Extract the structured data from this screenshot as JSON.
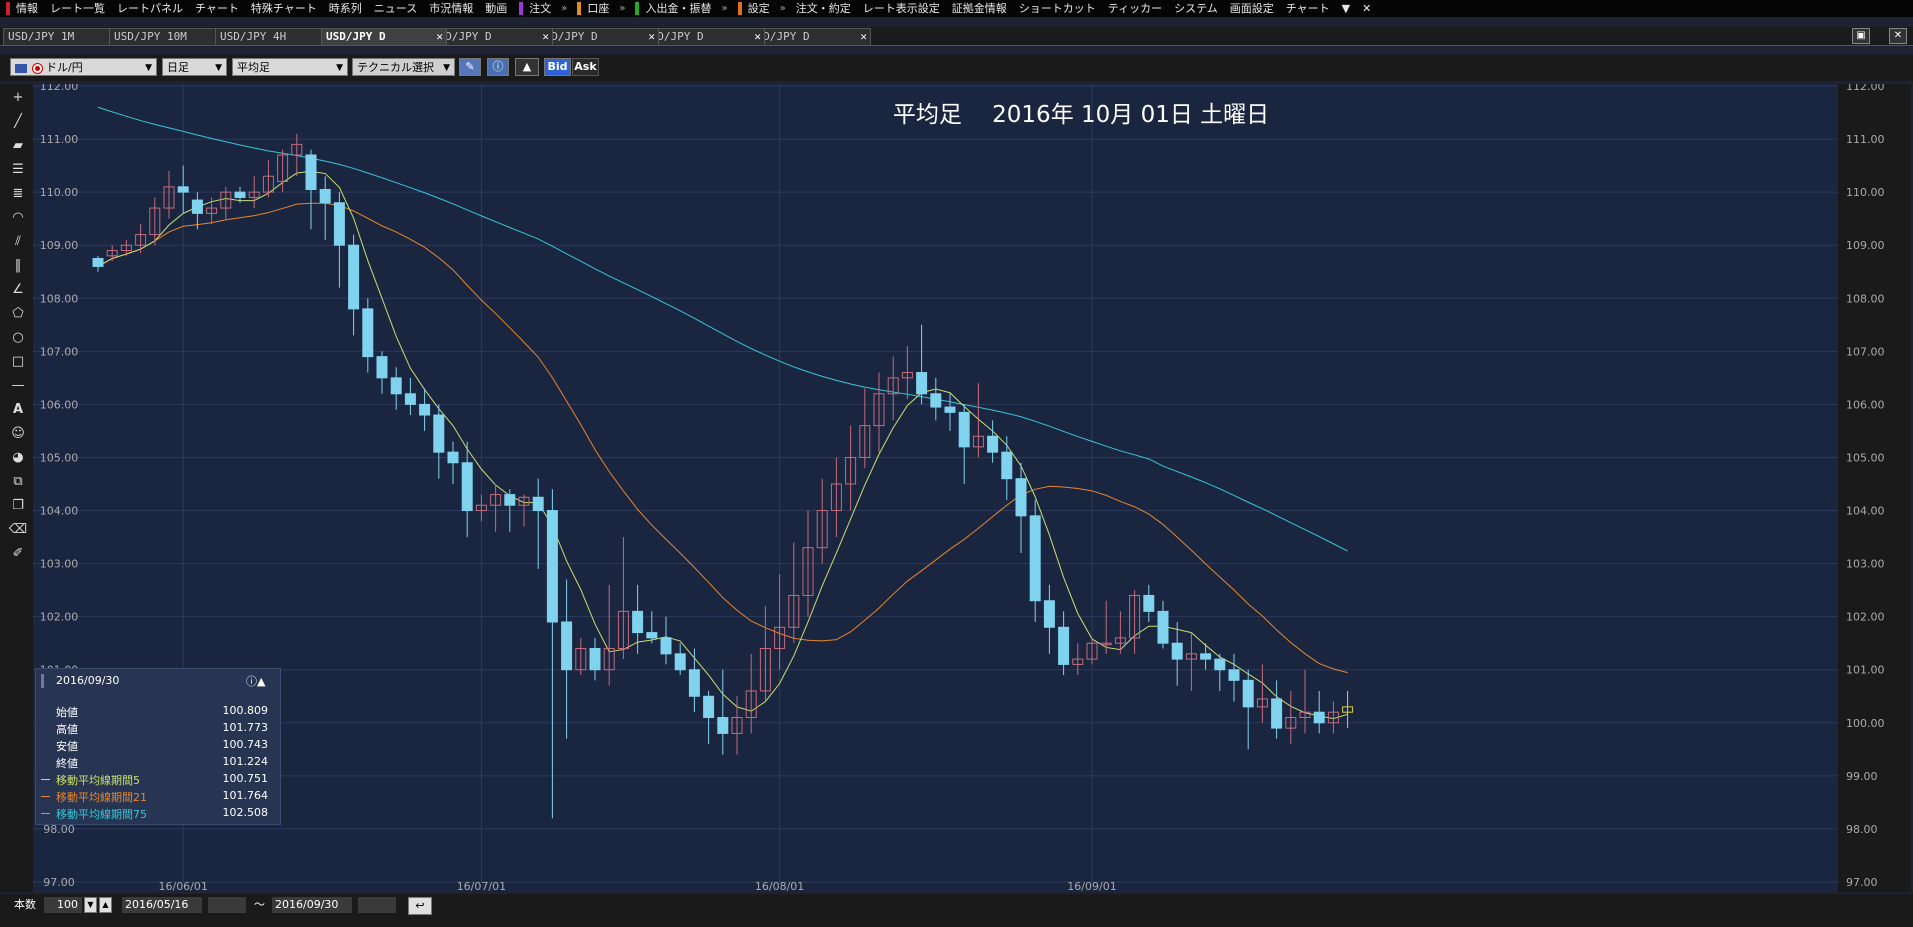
{
  "menu": {
    "items": [
      {
        "label": "情報",
        "sep": "#cc2222"
      },
      {
        "label": "レート一覧"
      },
      {
        "label": "レートパネル"
      },
      {
        "label": "チャート"
      },
      {
        "label": "特殊チャート"
      },
      {
        "label": "時系列"
      },
      {
        "label": "ニュース"
      },
      {
        "label": "市況情報"
      },
      {
        "label": "動画"
      },
      {
        "label": "注文",
        "sep": "#9a3ad0",
        "more": true
      },
      {
        "label": "口座",
        "sep": "#e09020",
        "more": true
      },
      {
        "label": "入出金・振替",
        "sep": "#22aa22",
        "more": true
      },
      {
        "label": "設定",
        "sep": "#e07020",
        "more": true
      },
      {
        "label": "注文・約定"
      },
      {
        "label": "レート表示設定"
      },
      {
        "label": "証拠金情報"
      },
      {
        "label": "ショートカット"
      },
      {
        "label": "ティッカー"
      },
      {
        "label": "システム"
      },
      {
        "label": "画面設定"
      },
      {
        "label": "チャート"
      }
    ],
    "dropdown_glyph": "▼",
    "close_glyph": "✕"
  },
  "tabs": [
    {
      "label": "USD/JPY 1M"
    },
    {
      "label": "USD/JPY 10M"
    },
    {
      "label": "USD/JPY 4H"
    },
    {
      "label": "USD/JPY D",
      "active": true
    },
    {
      "label": "USD/JPY D"
    },
    {
      "label": "USD/JPY D"
    },
    {
      "label": "USD/JPY D"
    },
    {
      "label": "USD/JPY D"
    }
  ],
  "toolbar": {
    "pair": "ドル/円",
    "period": "日足",
    "chart_type": "平均足",
    "technical": "テクニカル選択",
    "bid": "Bid",
    "ask": "Ask"
  },
  "chart_title": "平均足　 2016年 10月 01日 土曜日",
  "info": {
    "date": "2016/09/30",
    "rows": [
      {
        "label": "始値",
        "value": "100.809"
      },
      {
        "label": "高値",
        "value": "101.773"
      },
      {
        "label": "安値",
        "value": "100.743"
      },
      {
        "label": "終値",
        "value": "101.224"
      },
      {
        "label": "移動平均線期間5",
        "value": "100.751",
        "color": "#c8e070"
      },
      {
        "label": "移動平均線期間21",
        "value": "101.764",
        "color": "#e8862c"
      },
      {
        "label": "移動平均線期間75",
        "value": "102.508",
        "color": "#36c8d8"
      }
    ]
  },
  "bottom": {
    "count_label": "本数",
    "count": "100",
    "from": "2016/05/16",
    "tilde": "～",
    "to": "2016/09/30"
  },
  "colors": {
    "up": "#c46c7c",
    "down": "#7fd3ee",
    "last": "#d8d040",
    "ma5": "#c8e070",
    "ma21": "#e8862c",
    "ma75": "#36c8d8",
    "plot_bg": "#1a2540"
  },
  "chart_data": {
    "type": "candlestick",
    "y_ticks": [
      "112.00",
      "111.00",
      "110.00",
      "109.00",
      "108.00",
      "107.00",
      "106.00",
      "105.00",
      "104.00",
      "103.00",
      "102.00",
      "101.00",
      "100.00",
      "99.00",
      "98.00",
      "97.00"
    ],
    "ylim": [
      97,
      112
    ],
    "x_ticks": [
      {
        "label": "16/06/01",
        "index": 6
      },
      {
        "label": "16/07/01",
        "index": 27
      },
      {
        "label": "16/08/01",
        "index": 48
      },
      {
        "label": "16/09/01",
        "index": 70
      }
    ],
    "candles": [
      [
        108.75,
        108.8,
        108.5,
        108.6
      ],
      [
        108.8,
        109.0,
        108.7,
        108.9
      ],
      [
        108.9,
        109.1,
        108.8,
        109.0
      ],
      [
        109.0,
        109.4,
        108.85,
        109.2
      ],
      [
        109.2,
        109.9,
        109.0,
        109.7
      ],
      [
        109.7,
        110.4,
        109.5,
        110.1
      ],
      [
        110.1,
        110.5,
        109.6,
        110.0
      ],
      [
        109.85,
        110.0,
        109.3,
        109.6
      ],
      [
        109.6,
        109.9,
        109.4,
        109.7
      ],
      [
        109.7,
        110.1,
        109.5,
        110.0
      ],
      [
        110.0,
        110.1,
        109.8,
        109.9
      ],
      [
        109.9,
        110.3,
        109.7,
        110.0
      ],
      [
        110.0,
        110.6,
        109.9,
        110.3
      ],
      [
        110.2,
        110.8,
        110.0,
        110.7
      ],
      [
        110.7,
        111.1,
        110.3,
        110.9
      ],
      [
        110.7,
        110.8,
        109.3,
        110.05
      ],
      [
        110.05,
        110.3,
        109.1,
        109.8
      ],
      [
        109.8,
        110.0,
        108.2,
        109.0
      ],
      [
        109.0,
        109.2,
        107.3,
        107.8
      ],
      [
        107.8,
        108.0,
        106.6,
        106.9
      ],
      [
        106.9,
        107.0,
        106.2,
        106.5
      ],
      [
        106.5,
        106.7,
        105.9,
        106.2
      ],
      [
        106.2,
        106.5,
        105.8,
        106.0
      ],
      [
        106.0,
        106.3,
        105.5,
        105.8
      ],
      [
        105.8,
        106.0,
        104.6,
        105.1
      ],
      [
        105.1,
        105.3,
        104.5,
        104.9
      ],
      [
        104.9,
        105.3,
        103.5,
        104.0
      ],
      [
        104.0,
        104.3,
        103.8,
        104.1
      ],
      [
        104.1,
        104.5,
        103.6,
        104.3
      ],
      [
        104.3,
        104.4,
        103.6,
        104.1
      ],
      [
        104.1,
        104.3,
        103.7,
        104.25
      ],
      [
        104.25,
        104.6,
        102.9,
        104.0
      ],
      [
        104.0,
        104.4,
        98.2,
        101.9
      ],
      [
        101.9,
        102.7,
        99.7,
        101.0
      ],
      [
        101.0,
        101.6,
        100.9,
        101.4
      ],
      [
        101.4,
        101.6,
        100.8,
        101.0
      ],
      [
        101.0,
        102.6,
        100.7,
        101.4
      ],
      [
        101.4,
        103.5,
        101.2,
        102.1
      ],
      [
        102.1,
        102.6,
        101.3,
        101.7
      ],
      [
        101.7,
        102.1,
        101.5,
        101.6
      ],
      [
        101.6,
        102.0,
        101.1,
        101.3
      ],
      [
        101.3,
        101.5,
        100.9,
        101.0
      ],
      [
        101.0,
        101.4,
        100.2,
        100.5
      ],
      [
        100.5,
        100.6,
        99.6,
        100.1
      ],
      [
        100.1,
        101.0,
        99.4,
        99.8
      ],
      [
        99.8,
        100.5,
        99.4,
        100.1
      ],
      [
        100.1,
        101.3,
        99.8,
        100.6
      ],
      [
        100.6,
        102.2,
        100.4,
        101.4
      ],
      [
        101.4,
        102.8,
        101.0,
        101.8
      ],
      [
        101.8,
        103.4,
        101.5,
        102.4
      ],
      [
        102.4,
        104.0,
        102.0,
        103.3
      ],
      [
        103.3,
        104.6,
        103.0,
        104.0
      ],
      [
        104.0,
        105.0,
        103.5,
        104.5
      ],
      [
        104.5,
        105.6,
        104.0,
        105.0
      ],
      [
        105.0,
        106.3,
        104.8,
        105.6
      ],
      [
        105.6,
        106.6,
        105.1,
        106.2
      ],
      [
        106.2,
        106.9,
        105.7,
        106.5
      ],
      [
        106.5,
        107.1,
        106.1,
        106.6
      ],
      [
        106.6,
        107.5,
        106.0,
        106.2
      ],
      [
        106.2,
        106.5,
        105.7,
        105.95
      ],
      [
        105.95,
        106.2,
        105.5,
        105.85
      ],
      [
        105.85,
        106.0,
        104.5,
        105.2
      ],
      [
        105.2,
        106.4,
        105.0,
        105.4
      ],
      [
        105.4,
        105.7,
        104.9,
        105.1
      ],
      [
        105.1,
        105.4,
        104.2,
        104.6
      ],
      [
        104.6,
        104.9,
        103.2,
        103.9
      ],
      [
        103.9,
        104.2,
        101.9,
        102.3
      ],
      [
        102.3,
        102.6,
        101.3,
        101.8
      ],
      [
        101.8,
        102.1,
        100.9,
        101.1
      ],
      [
        101.1,
        101.5,
        100.9,
        101.2
      ],
      [
        101.2,
        101.6,
        101.1,
        101.5
      ],
      [
        101.5,
        102.3,
        101.3,
        101.5
      ],
      [
        101.5,
        102.1,
        101.3,
        101.6
      ],
      [
        101.6,
        102.5,
        101.3,
        102.4
      ],
      [
        102.4,
        102.6,
        101.9,
        102.1
      ],
      [
        102.1,
        102.3,
        101.4,
        101.5
      ],
      [
        101.5,
        101.9,
        100.7,
        101.2
      ],
      [
        101.2,
        101.7,
        100.6,
        101.3
      ],
      [
        101.3,
        101.5,
        101.0,
        101.2
      ],
      [
        101.2,
        101.3,
        100.6,
        101.0
      ],
      [
        101.0,
        101.3,
        100.4,
        100.8
      ],
      [
        100.8,
        101.0,
        99.5,
        100.3
      ],
      [
        100.3,
        101.1,
        100.0,
        100.45
      ],
      [
        100.45,
        100.8,
        99.7,
        99.9
      ],
      [
        99.9,
        100.6,
        99.6,
        100.1
      ],
      [
        100.1,
        101.0,
        99.8,
        100.2
      ],
      [
        100.2,
        100.6,
        99.8,
        100.0
      ],
      [
        100.0,
        100.4,
        99.8,
        100.2
      ],
      [
        100.2,
        100.6,
        99.9,
        100.3
      ]
    ]
  }
}
